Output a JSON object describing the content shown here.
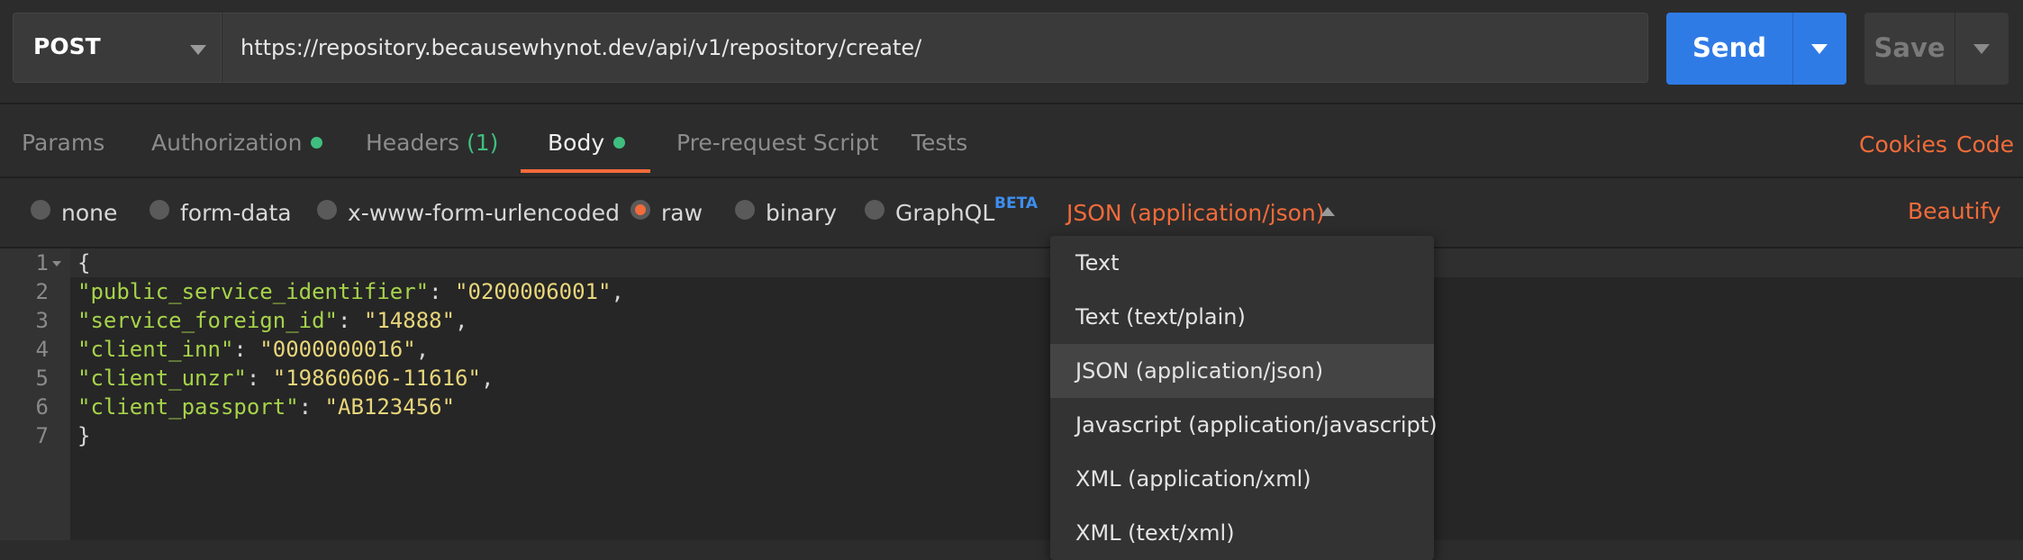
{
  "request": {
    "method": "POST",
    "url": "https://repository.becausewhynot.dev/api/v1/repository/create/",
    "send_label": "Send",
    "save_label": "Save"
  },
  "tabs": {
    "params": "Params",
    "authorization": "Authorization",
    "headers": "Headers",
    "headers_count": "(1)",
    "body": "Body",
    "prerequest": "Pre-request Script",
    "tests": "Tests",
    "cookies": "Cookies",
    "code": "Code"
  },
  "body_options": {
    "items": [
      "none",
      "form-data",
      "x-www-form-urlencoded",
      "raw",
      "binary",
      "GraphQL"
    ],
    "selected": "raw",
    "graphql_badge": "BETA",
    "format": "JSON (application/json)",
    "beautify": "Beautify"
  },
  "editor": {
    "line_numbers": [
      "1",
      "2",
      "3",
      "4",
      "5",
      "6",
      "7"
    ],
    "open_brace": "{",
    "close_brace": "}",
    "fields": [
      {
        "key": "\"public_service_identifier\"",
        "value": "\"0200006001\"",
        "sep": ": ",
        "trail": ","
      },
      {
        "key": "\"service_foreign_id\"",
        "value": "\"14888\"",
        "sep": ": ",
        "trail": ","
      },
      {
        "key": "\"client_inn\"",
        "value": "\"0000000016\"",
        "sep": ": ",
        "trail": ","
      },
      {
        "key": "\"client_unzr\"",
        "value": "\"19860606-11616\"",
        "sep": ": ",
        "trail": ","
      },
      {
        "key": "\"client_passport\"",
        "value": "\"AB123456\"",
        "sep": ": ",
        "trail": ""
      }
    ]
  },
  "format_menu": {
    "items": [
      "Text",
      "Text (text/plain)",
      "JSON (application/json)",
      "Javascript (application/javascript)",
      "XML (application/xml)",
      "XML (text/xml)"
    ],
    "highlighted": "JSON (application/json)"
  },
  "colors": {
    "accent": "#f26b3a",
    "send": "#2f7be6",
    "status_dot": "#3fbf7f"
  }
}
